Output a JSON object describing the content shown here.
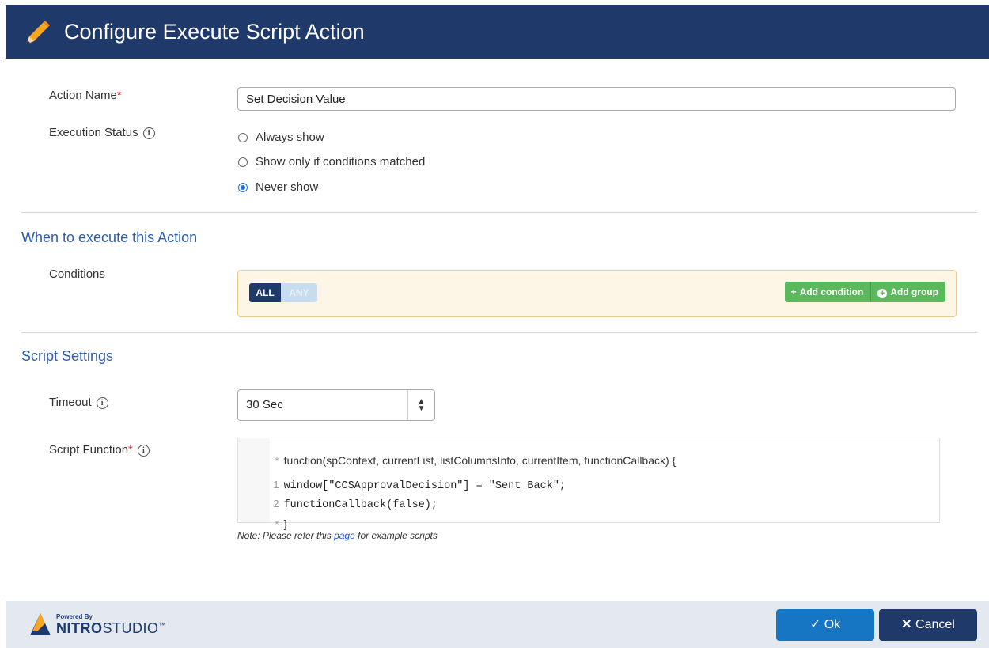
{
  "header": {
    "title": "Configure Execute Script Action",
    "icon": "pencil-icon"
  },
  "form": {
    "action_name_label": "Action Name",
    "required_mark": "*",
    "action_name_value": "Set Decision Value",
    "execution_status_label": "Execution Status",
    "info_glyph": "i",
    "radio_options": [
      "Always show",
      "Show only if conditions matched",
      "Never show"
    ],
    "selected_option": "Never show"
  },
  "when_section": {
    "title": "When to execute this Action",
    "conditions_label": "Conditions",
    "toggle_all": "ALL",
    "toggle_any": "ANY",
    "add_condition": "Add condition",
    "add_group": "Add group"
  },
  "script_section": {
    "title": "Script Settings",
    "timeout_label": "Timeout",
    "timeout_value": "30 Sec",
    "script_function_label": "Script Function",
    "code_lines": [
      {
        "num": "*",
        "text": "function(spContext, currentList, listColumnsInfo, currentItem, functionCallback) {"
      },
      {
        "num": "1",
        "text": "window[\"CCSApprovalDecision\"] = \"Sent Back\";"
      },
      {
        "num": "2",
        "text": "functionCallback(false);"
      },
      {
        "num": "*",
        "text": "}"
      }
    ],
    "note_prefix": "Note: Please refer this",
    "note_link": "page",
    "note_suffix": "for example scripts"
  },
  "footer": {
    "powered_by": "Powered By",
    "brand_bold": "NITRO",
    "brand_rest": "STUDIO",
    "tm": "™",
    "ok_label": "Ok",
    "cancel_label": "Cancel"
  },
  "colors": {
    "header_bg": "#20396b",
    "section_title": "#2f5ea8",
    "ok_button": "#1676c4",
    "cancel_button": "#20396b",
    "green_button": "#5cb85c"
  }
}
